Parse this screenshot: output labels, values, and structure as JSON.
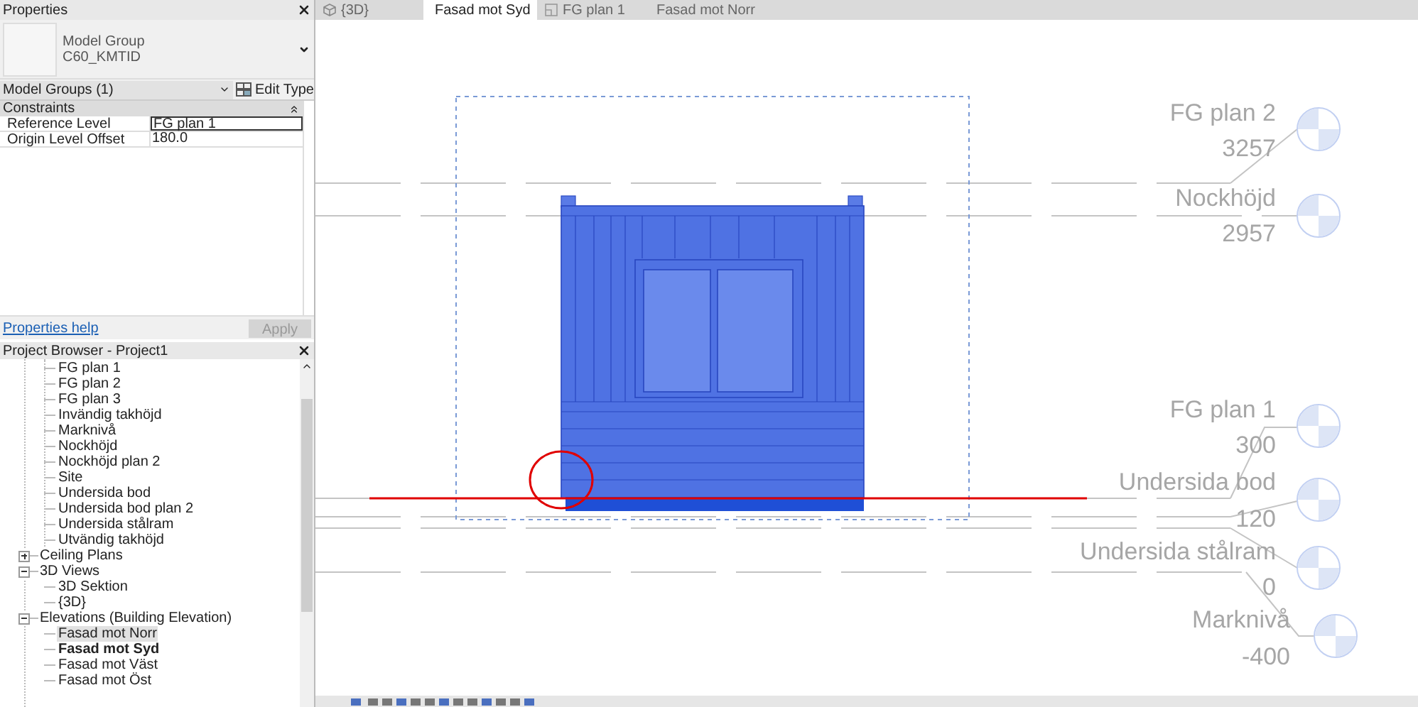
{
  "properties": {
    "title": "Properties",
    "type_selector": {
      "category": "Model Group",
      "type": "C60_KMTID"
    },
    "instance_filter": "Model Groups (1)",
    "edit_type_button": "Edit Type",
    "sections": [
      {
        "title": "Constraints",
        "expanded": true,
        "rows": [
          {
            "label": "Reference Level",
            "value": "FG plan 1",
            "selected": true
          },
          {
            "label": "Origin Level Offset",
            "value": "180.0",
            "selected": false
          }
        ]
      }
    ],
    "help_link": "Properties help",
    "apply_button": {
      "label": "Apply",
      "disabled": true
    }
  },
  "project_browser": {
    "title": "Project Browser - Project1",
    "partial_group_items": [
      {
        "label": "FG plan 1",
        "selected": false,
        "active": false
      },
      {
        "label": "FG plan 2",
        "selected": false,
        "active": false
      },
      {
        "label": "FG plan 3",
        "selected": false,
        "active": false
      },
      {
        "label": "Invändig takhöjd",
        "selected": false,
        "active": false
      },
      {
        "label": "Marknivå",
        "selected": false,
        "active": false
      },
      {
        "label": "Nockhöjd",
        "selected": false,
        "active": false
      },
      {
        "label": "Nockhöjd plan 2",
        "selected": false,
        "active": false
      },
      {
        "label": "Site",
        "selected": false,
        "active": false
      },
      {
        "label": "Undersida bod",
        "selected": false,
        "active": false
      },
      {
        "label": "Undersida bod plan 2",
        "selected": false,
        "active": false
      },
      {
        "label": "Undersida stålram",
        "selected": false,
        "active": false
      },
      {
        "label": "Utvändig takhöjd",
        "selected": false,
        "active": false
      }
    ],
    "groups": [
      {
        "label": "Ceiling Plans",
        "expanded": false
      },
      {
        "label": "3D Views",
        "expanded": true,
        "children": [
          {
            "label": "3D Sektion",
            "selected": false,
            "active": false
          },
          {
            "label": "{3D}",
            "selected": false,
            "active": false
          }
        ]
      },
      {
        "label": "Elevations (Building Elevation)",
        "expanded": true,
        "children": [
          {
            "label": "Fasad mot Norr",
            "selected": true,
            "active": false
          },
          {
            "label": "Fasad mot Syd",
            "selected": false,
            "active": true
          },
          {
            "label": "Fasad mot Väst",
            "selected": false,
            "active": false
          },
          {
            "label": "Fasad mot Öst",
            "selected": false,
            "active": false
          }
        ]
      }
    ]
  },
  "tabs": [
    {
      "label": "{3D}",
      "kind": "perspective",
      "selected": false
    },
    {
      "label": "Fasad mot Syd",
      "kind": "elevation",
      "selected": true
    },
    {
      "label": "FG plan 1",
      "kind": "plan",
      "selected": false
    },
    {
      "label": "Fasad mot Norr",
      "kind": "elevation",
      "selected": false
    }
  ],
  "levels": [
    {
      "name": "FG plan 2",
      "elevation": "3257"
    },
    {
      "name": "Nockhöjd",
      "elevation": "2957"
    },
    {
      "name": "FG plan 1",
      "elevation": "300"
    },
    {
      "name": "Undersida bod",
      "elevation": "120"
    },
    {
      "name": "Undersida stålram",
      "elevation": "0"
    },
    {
      "name": "Marknivå",
      "elevation": "-400"
    }
  ]
}
